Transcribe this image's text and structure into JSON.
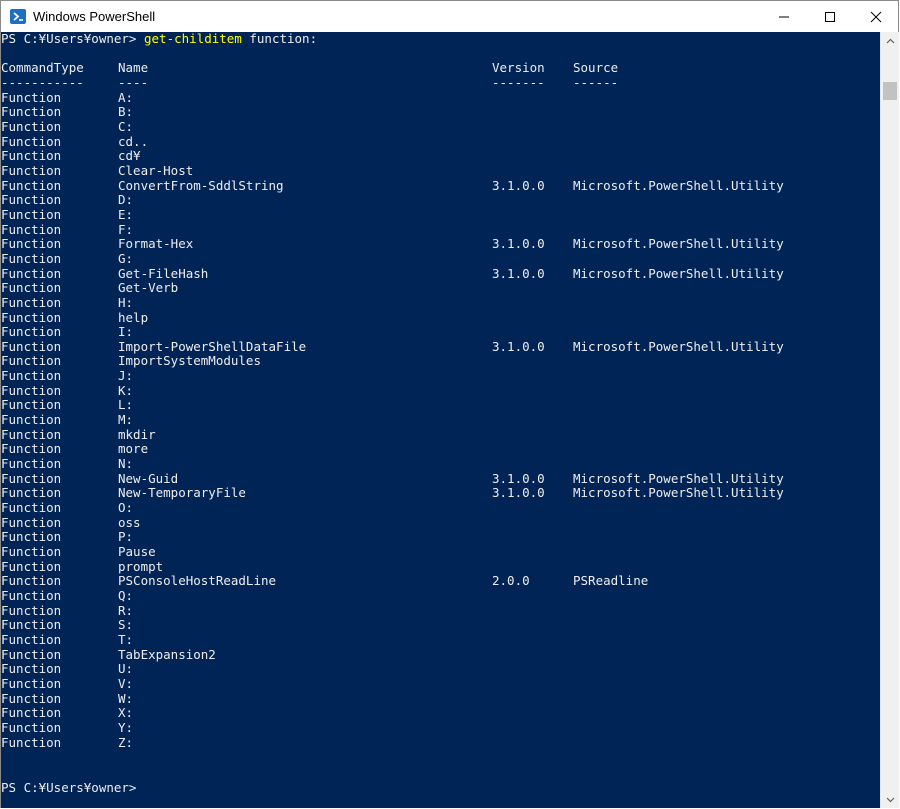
{
  "window": {
    "title": "Windows PowerShell"
  },
  "colors": {
    "console_bg": "#012456",
    "console_fg": "#eeedf0",
    "command": "#ffff00"
  },
  "titlebar_controls": {
    "minimize_icon": "minimize-icon",
    "maximize_icon": "maximize-icon",
    "close_icon": "close-icon"
  },
  "console": {
    "prompt_text": "PS C:¥Users¥owner> ",
    "command": "get-childitem",
    "argument": " function:",
    "headers": {
      "type": "CommandType",
      "name": "Name",
      "version": "Version",
      "source": "Source"
    },
    "underlines": {
      "type": "-----------",
      "name": "----",
      "version": "-------",
      "source": "------"
    },
    "rows": [
      {
        "type": "Function",
        "name": "A:",
        "version": "",
        "source": ""
      },
      {
        "type": "Function",
        "name": "B:",
        "version": "",
        "source": ""
      },
      {
        "type": "Function",
        "name": "C:",
        "version": "",
        "source": ""
      },
      {
        "type": "Function",
        "name": "cd..",
        "version": "",
        "source": ""
      },
      {
        "type": "Function",
        "name": "cd¥",
        "version": "",
        "source": ""
      },
      {
        "type": "Function",
        "name": "Clear-Host",
        "version": "",
        "source": ""
      },
      {
        "type": "Function",
        "name": "ConvertFrom-SddlString",
        "version": "3.1.0.0",
        "source": "Microsoft.PowerShell.Utility"
      },
      {
        "type": "Function",
        "name": "D:",
        "version": "",
        "source": ""
      },
      {
        "type": "Function",
        "name": "E:",
        "version": "",
        "source": ""
      },
      {
        "type": "Function",
        "name": "F:",
        "version": "",
        "source": ""
      },
      {
        "type": "Function",
        "name": "Format-Hex",
        "version": "3.1.0.0",
        "source": "Microsoft.PowerShell.Utility"
      },
      {
        "type": "Function",
        "name": "G:",
        "version": "",
        "source": ""
      },
      {
        "type": "Function",
        "name": "Get-FileHash",
        "version": "3.1.0.0",
        "source": "Microsoft.PowerShell.Utility"
      },
      {
        "type": "Function",
        "name": "Get-Verb",
        "version": "",
        "source": ""
      },
      {
        "type": "Function",
        "name": "H:",
        "version": "",
        "source": ""
      },
      {
        "type": "Function",
        "name": "help",
        "version": "",
        "source": ""
      },
      {
        "type": "Function",
        "name": "I:",
        "version": "",
        "source": ""
      },
      {
        "type": "Function",
        "name": "Import-PowerShellDataFile",
        "version": "3.1.0.0",
        "source": "Microsoft.PowerShell.Utility"
      },
      {
        "type": "Function",
        "name": "ImportSystemModules",
        "version": "",
        "source": ""
      },
      {
        "type": "Function",
        "name": "J:",
        "version": "",
        "source": ""
      },
      {
        "type": "Function",
        "name": "K:",
        "version": "",
        "source": ""
      },
      {
        "type": "Function",
        "name": "L:",
        "version": "",
        "source": ""
      },
      {
        "type": "Function",
        "name": "M:",
        "version": "",
        "source": ""
      },
      {
        "type": "Function",
        "name": "mkdir",
        "version": "",
        "source": ""
      },
      {
        "type": "Function",
        "name": "more",
        "version": "",
        "source": ""
      },
      {
        "type": "Function",
        "name": "N:",
        "version": "",
        "source": ""
      },
      {
        "type": "Function",
        "name": "New-Guid",
        "version": "3.1.0.0",
        "source": "Microsoft.PowerShell.Utility"
      },
      {
        "type": "Function",
        "name": "New-TemporaryFile",
        "version": "3.1.0.0",
        "source": "Microsoft.PowerShell.Utility"
      },
      {
        "type": "Function",
        "name": "O:",
        "version": "",
        "source": ""
      },
      {
        "type": "Function",
        "name": "oss",
        "version": "",
        "source": ""
      },
      {
        "type": "Function",
        "name": "P:",
        "version": "",
        "source": ""
      },
      {
        "type": "Function",
        "name": "Pause",
        "version": "",
        "source": ""
      },
      {
        "type": "Function",
        "name": "prompt",
        "version": "",
        "source": ""
      },
      {
        "type": "Function",
        "name": "PSConsoleHostReadLine",
        "version": "2.0.0",
        "source": "PSReadline"
      },
      {
        "type": "Function",
        "name": "Q:",
        "version": "",
        "source": ""
      },
      {
        "type": "Function",
        "name": "R:",
        "version": "",
        "source": ""
      },
      {
        "type": "Function",
        "name": "S:",
        "version": "",
        "source": ""
      },
      {
        "type": "Function",
        "name": "T:",
        "version": "",
        "source": ""
      },
      {
        "type": "Function",
        "name": "TabExpansion2",
        "version": "",
        "source": ""
      },
      {
        "type": "Function",
        "name": "U:",
        "version": "",
        "source": ""
      },
      {
        "type": "Function",
        "name": "V:",
        "version": "",
        "source": ""
      },
      {
        "type": "Function",
        "name": "W:",
        "version": "",
        "source": ""
      },
      {
        "type": "Function",
        "name": "X:",
        "version": "",
        "source": ""
      },
      {
        "type": "Function",
        "name": "Y:",
        "version": "",
        "source": ""
      },
      {
        "type": "Function",
        "name": "Z:",
        "version": "",
        "source": ""
      }
    ],
    "final_prompt": "PS C:¥Users¥owner>"
  },
  "scrollbar": {
    "up_icon": "arrow-up-icon",
    "down_icon": "arrow-down-icon"
  }
}
